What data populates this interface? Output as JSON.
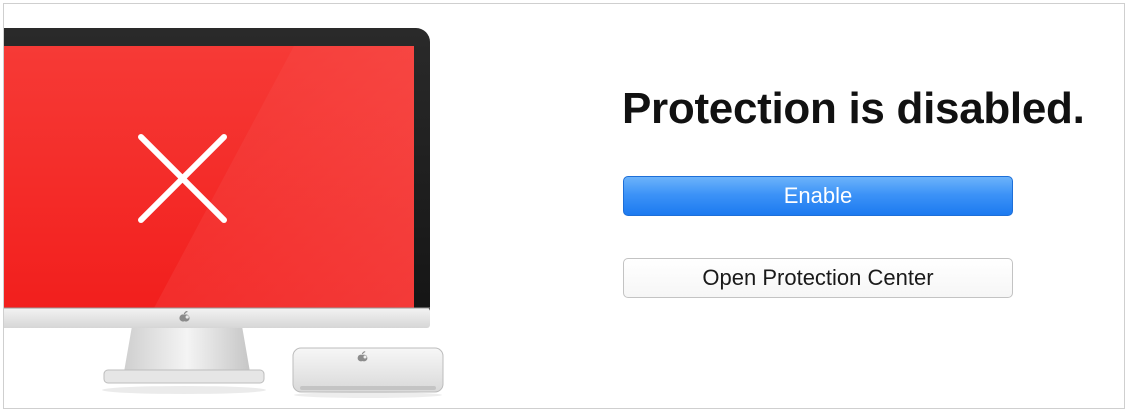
{
  "status": {
    "title": "Protection is disabled.",
    "state_color": "#f52a2a",
    "icon": "x-mark-icon"
  },
  "actions": {
    "enable_label": "Enable",
    "open_center_label": "Open Protection Center",
    "primary_color": "#2b86f5"
  },
  "illustration": {
    "monitor": "monitor-icon",
    "mini_pc": "mac-mini-icon",
    "logo": "apple-logo-icon"
  }
}
